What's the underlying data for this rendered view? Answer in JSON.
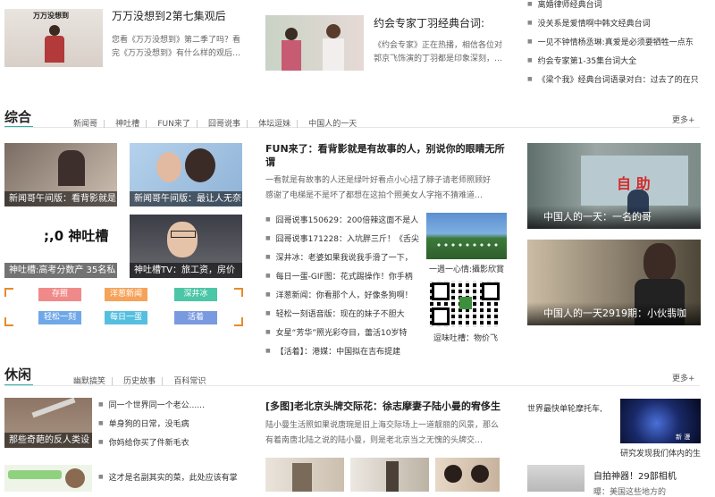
{
  "top": {
    "card1": {
      "title": "万万没想到2第七集观后",
      "desc_line1": "您看《万万没想到》第二季了吗？看",
      "desc_line2": "完《万万没想到》有什么样的观后…",
      "thumb_text": "万万没想到"
    },
    "card2": {
      "title": "约会专家丁羽经典台词:",
      "desc_line1": "《约会专家》正在热播，相信各位对",
      "desc_line2": "郭京飞饰演的丁羽都是印象深刻，…"
    },
    "list": [
      "离婚律师经典台词",
      "没关系是爱情啊中韩文经典台词",
      "一见不钟情杨丞琳:真爱是必须要牺牲一点东",
      "约会专家第1-35集台词大全",
      "《梁个我》经典台词语录对白：过去了的在只"
    ]
  },
  "zonghe": {
    "title": "综合",
    "nav": [
      "新闻哥",
      "神吐槽",
      "FUN来了",
      "囧哥说事",
      "体坛逗妹",
      "中国人的一天"
    ],
    "more": "更多+",
    "thumbs": [
      "新闻哥午间版：看背影就是",
      "新闻哥午间版：最让人无奈",
      "神吐槽:高考分数产 35名私",
      "神吐槽TV：旅工资，房价"
    ],
    "shentucao_logo": ";,0 神吐槽",
    "tags": [
      "存照",
      "洋葱新闻",
      "深井冰",
      "轻松一刻",
      "每日一蛋",
      "活着"
    ],
    "headline": {
      "line1": "FUN来了：看背影就是有故事的人，别说你的眼睛无所",
      "line2": "谓"
    },
    "summary": {
      "line1": "一看就是有故事的人还是绿叶好看点小心扭了脖子请老师照顾好",
      "line2": "感谢了电梯是不是坏了都想在这拍个照美女人字拖不猜难道…"
    },
    "bullets": [
      "囧哥说事150629：200倍辣这面不是人",
      "囧哥说事171228：入坑胖三斤！《舌尖",
      "深井冰：老婆如果我说我手滑了一下，",
      "每日一蛋-GIF图：花式踢操作！你手柄",
      "洋葱新闻：你看那个人，好像条狗啊！",
      "轻松一刻语音版：现在的妹子不胆大",
      "女星“芳华”照光彩夺目，蕾活10岁特",
      "【活着】：港媒：中国拟在吉布提建"
    ],
    "mid_img1_caption": "一週一心情:攝影欣賞",
    "qr_caption": "逗味吐槽：物价飞",
    "right1_caption": "中国人的一天：一名的哥",
    "right1_sign": "自 助",
    "right2_caption": "中国人的一天2919期：小伙翡咖"
  },
  "xiuxian": {
    "title": "休闲",
    "nav": [
      "幽默搞笑",
      "历史故事",
      "百科常识"
    ],
    "more": "更多+",
    "thumb1_caption": "那些奇葩的反人类设",
    "list1": [
      "同一个世界同一个老公......",
      "单身狗的日常，没毛病",
      "你妈给你买了件新毛衣"
    ],
    "list2_item": "这才是名副其实的菜，此处应该有掌",
    "headline": "[多图]老北京头牌交际花：徐志摩妻子陆小曼的宥侈生",
    "summary": {
      "line1": "陆小曼生活照如果说唐琬是旧上海交际场上一道靓丽的风景，那么",
      "line2": "有着南唐北陆之说的陆小曼，则是老北京当之无愧的头牌交…"
    },
    "right_text": "世界最快单轮摩托车,",
    "right_thumb_caption": "研究发现我们体内的生",
    "right_item2": "自拍神器！29部相机",
    "right_item2_sub": "曝：美国这些地方的"
  }
}
